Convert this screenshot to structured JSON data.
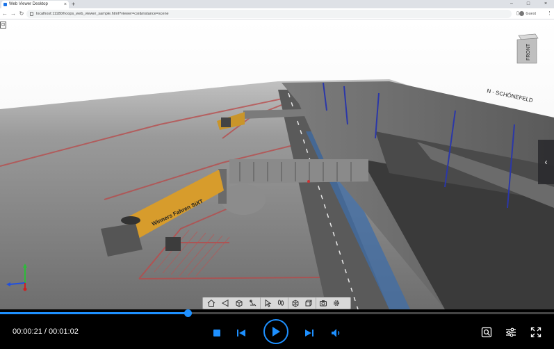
{
  "browser": {
    "tab_title": "Web Viewer Desktop",
    "tab_close": "×",
    "new_tab": "+",
    "url": "localhost:11180/hoops_web_viewer_sample.html?viewer=csr&instance=scene",
    "profile_label": "Guest",
    "window_controls": [
      "–",
      "□",
      "×"
    ]
  },
  "viewer": {
    "corner_button": "⊡",
    "view_cube_label": "FRONT",
    "side_panel_toggle": "‹",
    "toolbar_tools": [
      "home",
      "camera",
      "view-orientation",
      "note",
      "select",
      "explode",
      "model-tree",
      "box",
      "snapshot",
      "settings"
    ]
  },
  "scene": {
    "sign_text": "N - SCHÖNEFELD",
    "jetbridge_text": "Winners Fahren SiXT",
    "accent": "#1e90ff"
  },
  "player": {
    "current_time": "00:00:21",
    "duration": "00:01:02",
    "time_display": "00:00:21 / 00:01:02",
    "progress_fraction": 0.339,
    "accent": "#1e90ff"
  }
}
